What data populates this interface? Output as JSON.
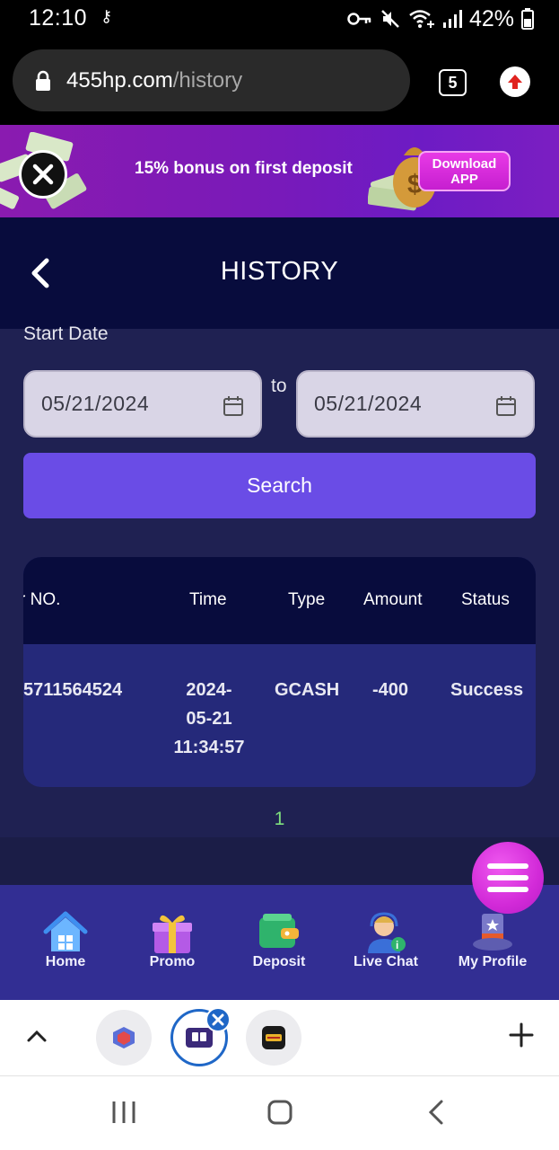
{
  "status_bar": {
    "time": "12:10",
    "battery": "42%"
  },
  "browser": {
    "url_domain": "455hp.com",
    "url_path": "/history",
    "tab_count": "5"
  },
  "promo": {
    "text": "15% bonus on first deposit",
    "download_line1": "Download",
    "download_line2": "APP"
  },
  "header": {
    "title": "HISTORY"
  },
  "filters": {
    "start_label": "Start Date",
    "start_date": "05/21/2024",
    "to_label": "to",
    "end_date": "05/21/2024",
    "search_label": "Search"
  },
  "table": {
    "columns": [
      "r NO.",
      "Time",
      "Type",
      "Amount",
      "Status"
    ],
    "rows": [
      {
        "order_no": "5711564524",
        "time_line1": "2024-",
        "time_line2": "05-21",
        "time_line3": "11:34:57",
        "type": "GCASH",
        "amount": "-400",
        "status": "Success"
      }
    ]
  },
  "pagination": {
    "current": "1"
  },
  "bottom_nav": {
    "items": [
      {
        "label": "Home",
        "icon": "house-icon"
      },
      {
        "label": "Promo",
        "icon": "gift-icon"
      },
      {
        "label": "Deposit",
        "icon": "wallet-icon"
      },
      {
        "label": "Live Chat",
        "icon": "support-agent-icon"
      },
      {
        "label": "My Profile",
        "icon": "top-hat-icon"
      }
    ]
  },
  "colors": {
    "page_bg": "#1f2152",
    "header_bg": "#080c3d",
    "accent_button": "#6a4ce6",
    "nav_bg": "#322e93",
    "fab": "#d22ad8",
    "pager": "#7ee07e"
  }
}
